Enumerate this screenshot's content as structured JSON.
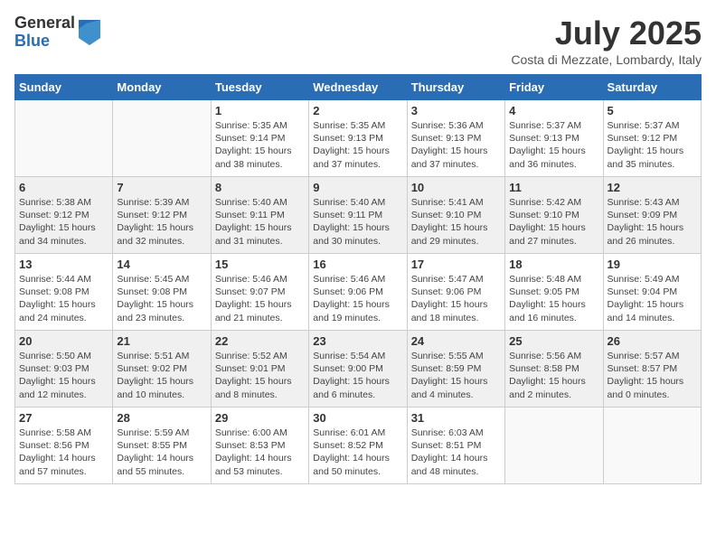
{
  "logo": {
    "general": "General",
    "blue": "Blue"
  },
  "title": "July 2025",
  "subtitle": "Costa di Mezzate, Lombardy, Italy",
  "weekdays": [
    "Sunday",
    "Monday",
    "Tuesday",
    "Wednesday",
    "Thursday",
    "Friday",
    "Saturday"
  ],
  "weeks": [
    [
      {
        "day": "",
        "info": ""
      },
      {
        "day": "",
        "info": ""
      },
      {
        "day": "1",
        "info": "Sunrise: 5:35 AM\nSunset: 9:14 PM\nDaylight: 15 hours and 38 minutes."
      },
      {
        "day": "2",
        "info": "Sunrise: 5:35 AM\nSunset: 9:13 PM\nDaylight: 15 hours and 37 minutes."
      },
      {
        "day": "3",
        "info": "Sunrise: 5:36 AM\nSunset: 9:13 PM\nDaylight: 15 hours and 37 minutes."
      },
      {
        "day": "4",
        "info": "Sunrise: 5:37 AM\nSunset: 9:13 PM\nDaylight: 15 hours and 36 minutes."
      },
      {
        "day": "5",
        "info": "Sunrise: 5:37 AM\nSunset: 9:12 PM\nDaylight: 15 hours and 35 minutes."
      }
    ],
    [
      {
        "day": "6",
        "info": "Sunrise: 5:38 AM\nSunset: 9:12 PM\nDaylight: 15 hours and 34 minutes."
      },
      {
        "day": "7",
        "info": "Sunrise: 5:39 AM\nSunset: 9:12 PM\nDaylight: 15 hours and 32 minutes."
      },
      {
        "day": "8",
        "info": "Sunrise: 5:40 AM\nSunset: 9:11 PM\nDaylight: 15 hours and 31 minutes."
      },
      {
        "day": "9",
        "info": "Sunrise: 5:40 AM\nSunset: 9:11 PM\nDaylight: 15 hours and 30 minutes."
      },
      {
        "day": "10",
        "info": "Sunrise: 5:41 AM\nSunset: 9:10 PM\nDaylight: 15 hours and 29 minutes."
      },
      {
        "day": "11",
        "info": "Sunrise: 5:42 AM\nSunset: 9:10 PM\nDaylight: 15 hours and 27 minutes."
      },
      {
        "day": "12",
        "info": "Sunrise: 5:43 AM\nSunset: 9:09 PM\nDaylight: 15 hours and 26 minutes."
      }
    ],
    [
      {
        "day": "13",
        "info": "Sunrise: 5:44 AM\nSunset: 9:08 PM\nDaylight: 15 hours and 24 minutes."
      },
      {
        "day": "14",
        "info": "Sunrise: 5:45 AM\nSunset: 9:08 PM\nDaylight: 15 hours and 23 minutes."
      },
      {
        "day": "15",
        "info": "Sunrise: 5:46 AM\nSunset: 9:07 PM\nDaylight: 15 hours and 21 minutes."
      },
      {
        "day": "16",
        "info": "Sunrise: 5:46 AM\nSunset: 9:06 PM\nDaylight: 15 hours and 19 minutes."
      },
      {
        "day": "17",
        "info": "Sunrise: 5:47 AM\nSunset: 9:06 PM\nDaylight: 15 hours and 18 minutes."
      },
      {
        "day": "18",
        "info": "Sunrise: 5:48 AM\nSunset: 9:05 PM\nDaylight: 15 hours and 16 minutes."
      },
      {
        "day": "19",
        "info": "Sunrise: 5:49 AM\nSunset: 9:04 PM\nDaylight: 15 hours and 14 minutes."
      }
    ],
    [
      {
        "day": "20",
        "info": "Sunrise: 5:50 AM\nSunset: 9:03 PM\nDaylight: 15 hours and 12 minutes."
      },
      {
        "day": "21",
        "info": "Sunrise: 5:51 AM\nSunset: 9:02 PM\nDaylight: 15 hours and 10 minutes."
      },
      {
        "day": "22",
        "info": "Sunrise: 5:52 AM\nSunset: 9:01 PM\nDaylight: 15 hours and 8 minutes."
      },
      {
        "day": "23",
        "info": "Sunrise: 5:54 AM\nSunset: 9:00 PM\nDaylight: 15 hours and 6 minutes."
      },
      {
        "day": "24",
        "info": "Sunrise: 5:55 AM\nSunset: 8:59 PM\nDaylight: 15 hours and 4 minutes."
      },
      {
        "day": "25",
        "info": "Sunrise: 5:56 AM\nSunset: 8:58 PM\nDaylight: 15 hours and 2 minutes."
      },
      {
        "day": "26",
        "info": "Sunrise: 5:57 AM\nSunset: 8:57 PM\nDaylight: 15 hours and 0 minutes."
      }
    ],
    [
      {
        "day": "27",
        "info": "Sunrise: 5:58 AM\nSunset: 8:56 PM\nDaylight: 14 hours and 57 minutes."
      },
      {
        "day": "28",
        "info": "Sunrise: 5:59 AM\nSunset: 8:55 PM\nDaylight: 14 hours and 55 minutes."
      },
      {
        "day": "29",
        "info": "Sunrise: 6:00 AM\nSunset: 8:53 PM\nDaylight: 14 hours and 53 minutes."
      },
      {
        "day": "30",
        "info": "Sunrise: 6:01 AM\nSunset: 8:52 PM\nDaylight: 14 hours and 50 minutes."
      },
      {
        "day": "31",
        "info": "Sunrise: 6:03 AM\nSunset: 8:51 PM\nDaylight: 14 hours and 48 minutes."
      },
      {
        "day": "",
        "info": ""
      },
      {
        "day": "",
        "info": ""
      }
    ]
  ]
}
